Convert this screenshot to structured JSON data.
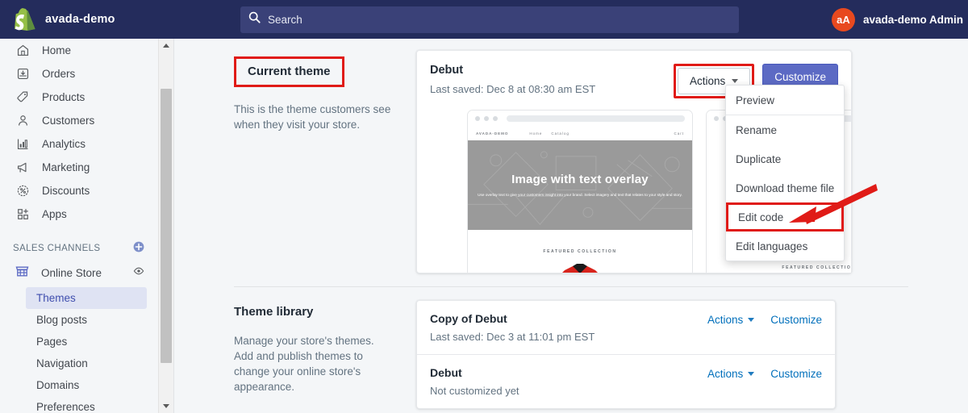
{
  "topbar": {
    "brand_name": "avada-demo",
    "logo_icon": "shopify-bag-icon",
    "search": {
      "icon": "search-icon",
      "placeholder": "Search",
      "value": ""
    },
    "user": {
      "avatar_initials": "aA",
      "name": "avada-demo Admin"
    },
    "background_color": "#242c5c"
  },
  "sidebar": {
    "nav": [
      {
        "label": "Home",
        "icon": "home-icon"
      },
      {
        "label": "Orders",
        "icon": "orders-inbox-icon"
      },
      {
        "label": "Products",
        "icon": "products-tag-icon"
      },
      {
        "label": "Customers",
        "icon": "customers-person-icon"
      },
      {
        "label": "Analytics",
        "icon": "analytics-bar-chart-icon"
      },
      {
        "label": "Marketing",
        "icon": "marketing-megaphone-icon"
      },
      {
        "label": "Discounts",
        "icon": "discounts-percent-icon"
      },
      {
        "label": "Apps",
        "icon": "apps-grid-plus-icon"
      }
    ],
    "sales_channels": {
      "title": "SALES CHANNELS",
      "add_icon": "plus-circle-icon",
      "channel": {
        "label": "Online Store",
        "icon": "store-icon",
        "view_icon": "eye-icon"
      },
      "items": [
        {
          "label": "Themes",
          "active": true
        },
        {
          "label": "Blog posts",
          "active": false
        },
        {
          "label": "Pages",
          "active": false
        },
        {
          "label": "Navigation",
          "active": false
        },
        {
          "label": "Domains",
          "active": false
        },
        {
          "label": "Preferences",
          "active": false
        }
      ]
    },
    "scrollbar": {
      "up_icon": "scroll-up-arrow-icon",
      "down_icon": "scroll-down-arrow-icon"
    }
  },
  "current_theme": {
    "heading": "Current theme",
    "description": "This is the theme customers see when they visit your store.",
    "theme_name": "Debut",
    "last_saved": "Last saved: Dec 8 at 08:30 am EST",
    "actions_label": "Actions",
    "customize_label": "Customize",
    "customize_color": "#5c6ac4",
    "preview": {
      "site_logo": "AVADA-DEMO",
      "nav": [
        "Home",
        "Catalog"
      ],
      "cart": "Cart",
      "hero_title": "Image with text overlay",
      "hero_subtitle": "Use overlay text to give your customers insight into your brand. Select imagery and text that relates to your style and story.",
      "featured_label": "FEATURED COLLECTION"
    },
    "preview_secondary": {
      "featured_label": "FEATURED COLLECTION"
    }
  },
  "actions_menu": {
    "items": [
      {
        "label": "Preview",
        "highlighted": false
      },
      {
        "label": "Rename",
        "highlighted": false
      },
      {
        "label": "Duplicate",
        "highlighted": false
      },
      {
        "label": "Download theme file",
        "highlighted": false
      },
      {
        "label": "Edit code",
        "highlighted": true
      },
      {
        "label": "Edit languages",
        "highlighted": false
      }
    ]
  },
  "theme_library": {
    "heading": "Theme library",
    "description": "Manage your store's themes. Add and publish themes to change your online store's appearance.",
    "rows": [
      {
        "name": "Copy of Debut",
        "sub": "Last saved: Dec 3 at 11:01 pm EST",
        "actions_label": "Actions",
        "customize_label": "Customize"
      },
      {
        "name": "Debut",
        "sub": "Not customized yet",
        "actions_label": "Actions",
        "customize_label": "Customize"
      }
    ]
  },
  "annotations": {
    "highlight_color": "#e01b17",
    "boxes": [
      "Current theme",
      "Actions",
      "Edit code"
    ],
    "arrow": "red-arrow-pointing-to-edit-code"
  }
}
